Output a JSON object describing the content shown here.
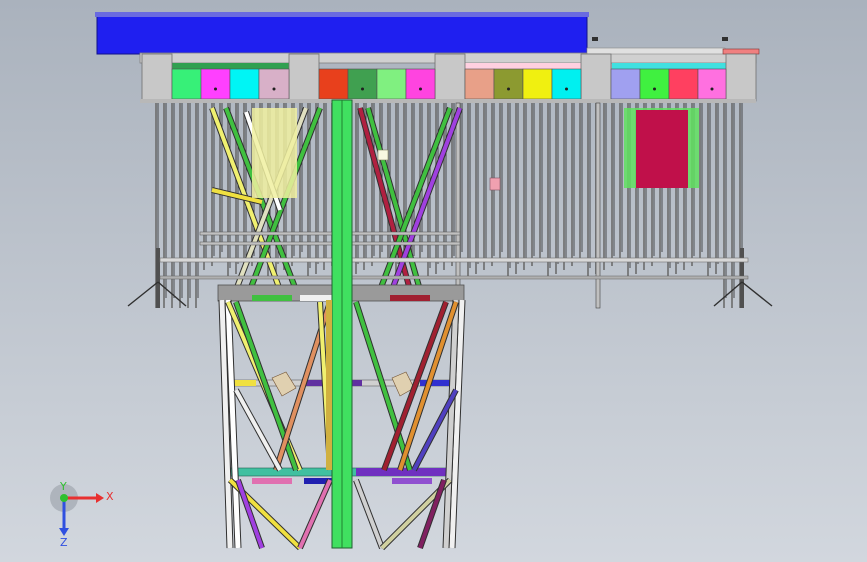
{
  "viewport": {
    "background_top": "#aab2bd",
    "background_bottom": "#d2d7de"
  },
  "model": {
    "deck_color": "#1f1ff0",
    "beam_color": "#c8c8c8",
    "leg_color": "#6c6c6c",
    "module_colors": [
      "#37f078",
      "#ff40ff",
      "#00f5f5",
      "#d8b0c8",
      "#e8401c",
      "#40a050",
      "#80f080",
      "#ff44e0",
      "#e8a088",
      "#8c9a30",
      "#f0f010",
      "#00f0f0",
      "#a0a0f0",
      "#40f040",
      "#ff4060",
      "#ff70e0"
    ],
    "brace_colors": [
      "#f0f070",
      "#40c040",
      "#a040e0",
      "#e09030",
      "#ffffff",
      "#b02040"
    ]
  },
  "triad": {
    "x_label": "X",
    "y_label": "Y",
    "z_label": "Z",
    "x_color": "#e83030",
    "y_color": "#30c030",
    "z_color": "#3050e0"
  }
}
